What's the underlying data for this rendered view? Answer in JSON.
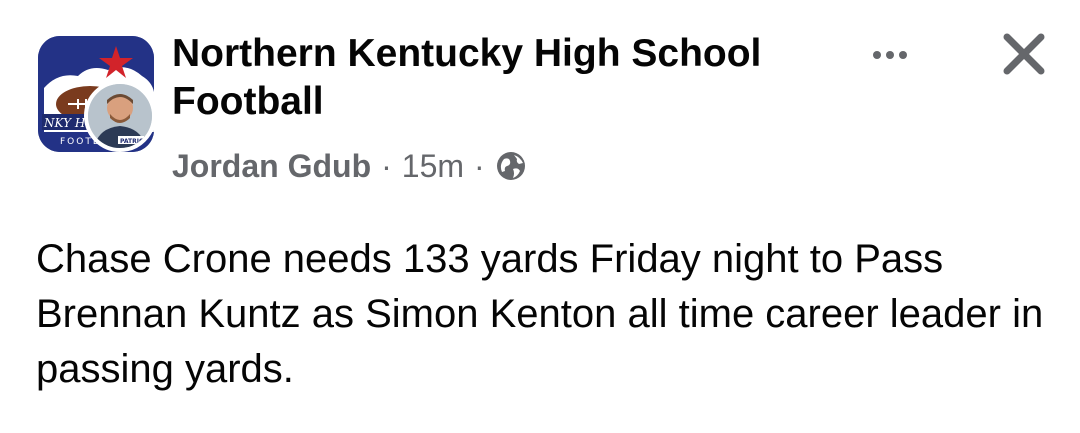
{
  "post": {
    "group_name": "Northern Kentucky High School Football",
    "author": "Jordan Gdub",
    "separator": "·",
    "time": "15m",
    "privacy_icon": "globe-icon",
    "body": "Chase Crone needs 133 yards Friday night to Pass Brennan Kuntz as Simon Kenton all time career leader in passing yards.",
    "group_logo_text": "NKY HS FOOTBALL",
    "user_badge_text": "PATRIOTS"
  },
  "actions": {
    "more_icon": "more-horizontal-icon",
    "close_icon": "close-icon"
  },
  "colors": {
    "primary_text": "#050505",
    "secondary_text": "#65676b",
    "background": "#ffffff",
    "logo_navy": "#1e2a6e",
    "logo_red": "#d2232a"
  }
}
